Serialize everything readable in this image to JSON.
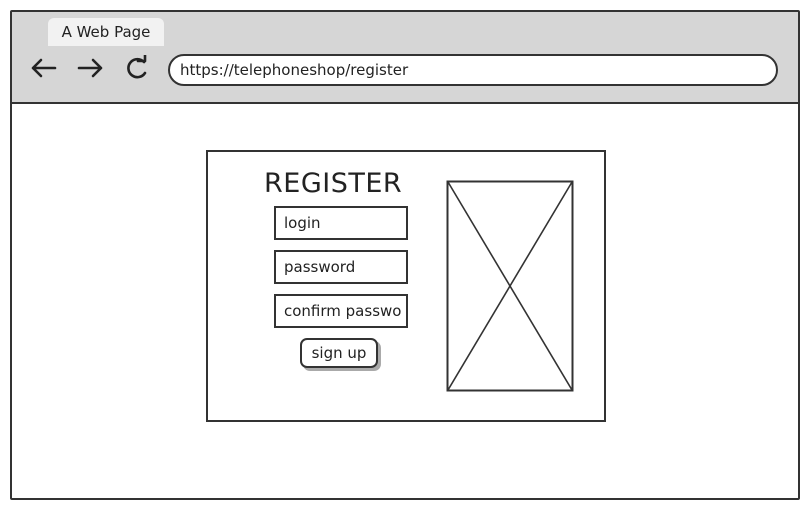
{
  "browser": {
    "tab_title": "A Web Page",
    "url": "https://telephoneshop/register",
    "icons": {
      "back": "arrow-left",
      "forward": "arrow-right",
      "reload": "reload"
    }
  },
  "register_form": {
    "title": "REGISTER",
    "fields": {
      "login_placeholder": "login",
      "password_placeholder": "password",
      "confirm_placeholder": "confirm passwo"
    },
    "submit_label": "sign up"
  },
  "image_placeholder": {
    "type": "crossed-box"
  },
  "colors": {
    "chrome": "#d6d6d6",
    "tab": "#f2f2f2",
    "stroke": "#333333",
    "shadow": "#aaaaaa"
  }
}
